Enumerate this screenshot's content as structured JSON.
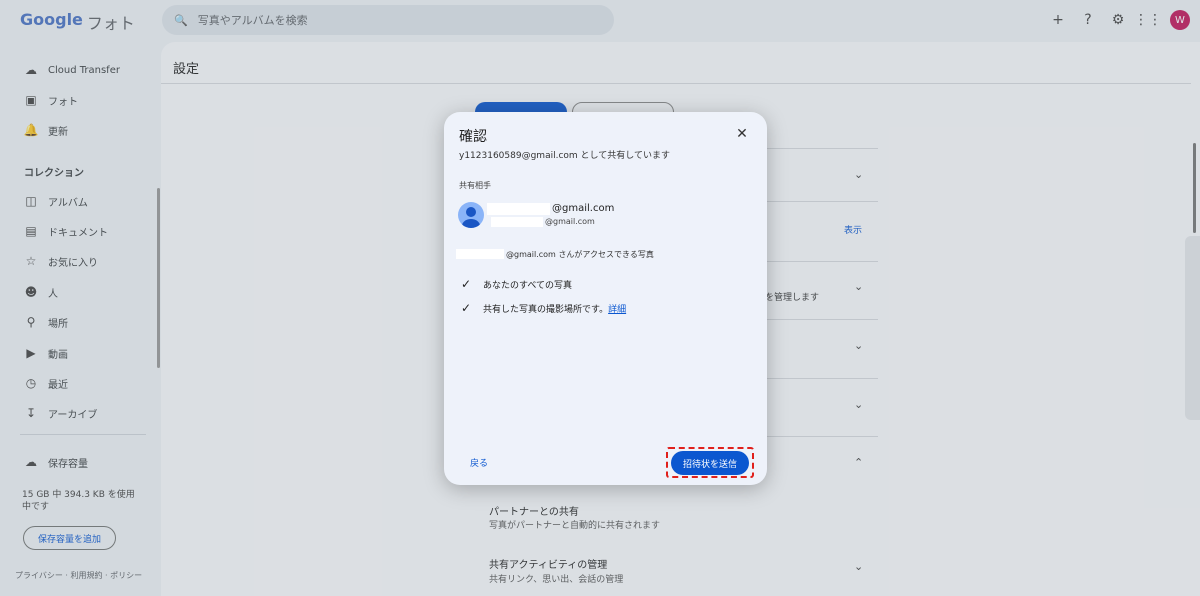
{
  "app": {
    "logo_google": "Google",
    "logo_photos": "フォト",
    "search_placeholder": "写真やアルバムを検索",
    "avatar_letter": "W"
  },
  "sidebar": {
    "items_top": [
      {
        "label": "Cloud Transfer",
        "icon": "cloud-sync-icon"
      },
      {
        "label": "フォト",
        "icon": "photo-icon"
      },
      {
        "label": "更新",
        "icon": "bell-icon"
      }
    ],
    "collections_heading": "コレクション",
    "collections": [
      {
        "label": "アルバム",
        "icon": "album-icon"
      },
      {
        "label": "ドキュメント",
        "icon": "document-icon"
      },
      {
        "label": "お気に入り",
        "icon": "star-icon"
      },
      {
        "label": "人",
        "icon": "face-icon"
      },
      {
        "label": "場所",
        "icon": "location-icon"
      },
      {
        "label": "動画",
        "icon": "play-icon"
      },
      {
        "label": "最近",
        "icon": "clock-icon"
      },
      {
        "label": "アーカイブ",
        "icon": "archive-icon"
      }
    ],
    "storage_label": "保存容量",
    "storage_usage": "15 GB 中 394.3 KB を使用中です",
    "storage_button": "保存容量を追加",
    "footer": "プライバシー · 利用規約 · ポリシー"
  },
  "main": {
    "title": "設定",
    "show_link": "表示",
    "manage_text": "を管理します",
    "partner_title": "パートナーとの共有",
    "partner_sub": "写真がパートナーと自動的に共有されます",
    "activity_title": "共有アクティビティの管理",
    "activity_sub": "共有リンク、思い出、会話の管理"
  },
  "dialog": {
    "title": "確認",
    "subtitle": "y1123160589@gmail.com として共有しています",
    "share_with_label": "共有相手",
    "contact_email_primary": "@gmail.com",
    "contact_email_secondary": "@gmail.com",
    "access_text": "@gmail.com さんがアクセスできる写真",
    "permissions": [
      {
        "label": "あなたのすべての写真"
      },
      {
        "label": "共有した写真の撮影場所です。",
        "link": "詳細"
      }
    ],
    "back_button": "戻る",
    "send_button": "招待状を送信"
  }
}
